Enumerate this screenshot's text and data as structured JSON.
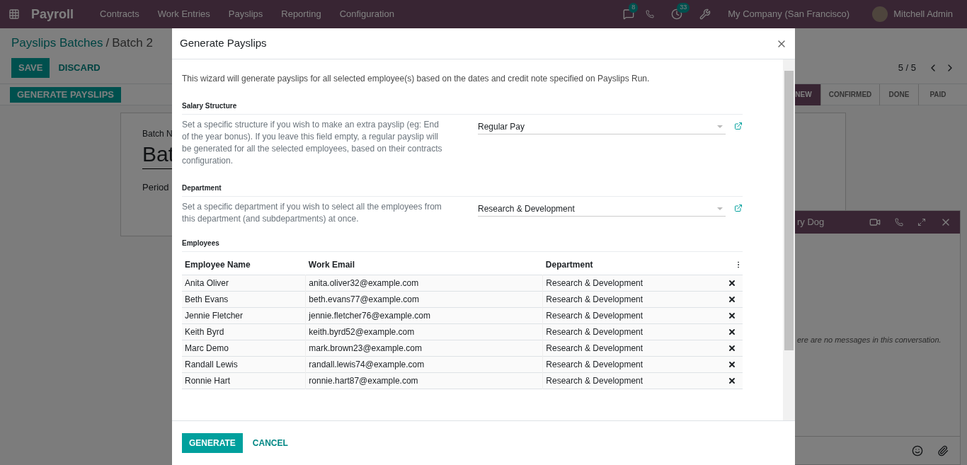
{
  "navbar": {
    "app_name": "Payroll",
    "menu": [
      "Contracts",
      "Work Entries",
      "Payslips",
      "Reporting",
      "Configuration"
    ],
    "message_count": "8",
    "activity_count": "33",
    "company": "My Company (San Francisco)",
    "user": "Mitchell Admin"
  },
  "breadcrumb": {
    "parent": "Payslips Batches",
    "separator": "/",
    "current": "Batch 2"
  },
  "actions": {
    "save": "SAVE",
    "discard": "DISCARD",
    "pager": "5 / 5"
  },
  "header_button": "GENERATE PAYSLIPS",
  "statuses": [
    {
      "label": "NEW",
      "selected": true
    },
    {
      "label": "CONFIRMED",
      "selected": false
    },
    {
      "label": "DONE",
      "selected": false
    },
    {
      "label": "PAID",
      "selected": false
    }
  ],
  "form": {
    "name_label": "Batch N",
    "name_value": "Bat",
    "period_label": "Period"
  },
  "chat": {
    "title": "ry Dog",
    "empty": "ere are no messages in this conversation."
  },
  "dialog": {
    "title": "Generate Payslips",
    "description": "This wizard will generate payslips for all selected employee(s) based on the dates and credit note specified on Payslips Run.",
    "sections": [
      {
        "title": "Salary Structure",
        "help": "Set a specific structure if you wish to make an extra payslip (eg: End of the year bonus). If you leave this field empty, a regular payslip will be generated for all the selected employees, based on their contracts configuration.",
        "value": "Regular Pay"
      },
      {
        "title": "Department",
        "help": "Set a specific department if you wish to select all the employees from this department (and subdepartments) at once.",
        "value": "Research & Development"
      }
    ],
    "employees_title": "Employees",
    "columns": [
      "Employee Name",
      "Work Email",
      "Department"
    ],
    "rows": [
      {
        "name": "Anita Oliver",
        "email": "anita.oliver32@example.com",
        "department": "Research & Development"
      },
      {
        "name": "Beth Evans",
        "email": "beth.evans77@example.com",
        "department": "Research & Development"
      },
      {
        "name": "Jennie Fletcher",
        "email": "jennie.fletcher76@example.com",
        "department": "Research & Development"
      },
      {
        "name": "Keith Byrd",
        "email": "keith.byrd52@example.com",
        "department": "Research & Development"
      },
      {
        "name": "Marc Demo",
        "email": "mark.brown23@example.com",
        "department": "Research & Development"
      },
      {
        "name": "Randall Lewis",
        "email": "randall.lewis74@example.com",
        "department": "Research & Development"
      },
      {
        "name": "Ronnie Hart",
        "email": "ronnie.hart87@example.com",
        "department": "Research & Development"
      }
    ],
    "generate": "GENERATE",
    "cancel": "CANCEL"
  }
}
